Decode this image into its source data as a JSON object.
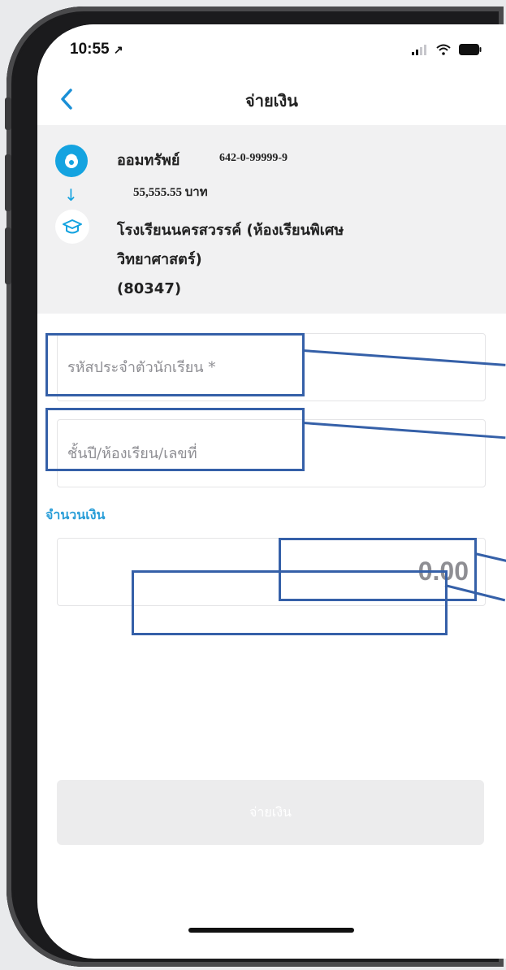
{
  "status_bar": {
    "time": "10:55",
    "location_arrow": "↗"
  },
  "nav": {
    "title": "จ่ายเงิน",
    "back_icon": "chevron-left-icon"
  },
  "from_account": {
    "name": "ออมทรัพย์",
    "number": "642-0-99999-9",
    "balance": "55,555.55 บาท",
    "icon": "bank-logo-icon"
  },
  "transfer_arrow": "↓",
  "to_biller": {
    "name_line1": "โรงเรียนนครสวรรค์ (ห้องเรียนพิเศษ",
    "name_line2": "วิทยาศาสตร์)",
    "code": "(80347)",
    "icon": "graduation-cap-icon"
  },
  "form": {
    "student_id_placeholder": "รหัสประจำตัวนักเรียน *",
    "class_placeholder": "ชั้นปี/ห้องเรียน/เลขที่",
    "amount_label": "จำนวนเงิน",
    "amount_value": "0.00"
  },
  "pay_button": {
    "label": "จ่ายเงิน"
  },
  "colors": {
    "accent": "#14a3e0",
    "label_blue": "#2a9ed8",
    "highlight": "#3560a8",
    "disabled_btn": "#ececed"
  }
}
